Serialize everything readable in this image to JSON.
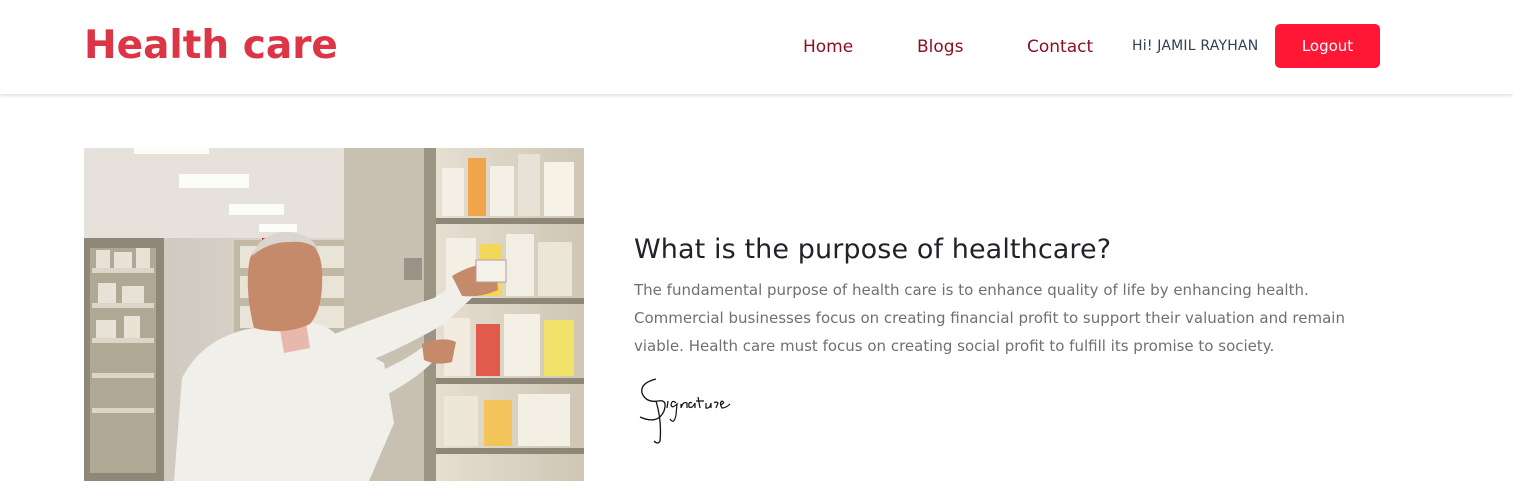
{
  "brand": {
    "name": "Health care",
    "color": "#dc3545"
  },
  "nav": {
    "links": [
      {
        "label": "Home"
      },
      {
        "label": "Blogs"
      },
      {
        "label": "Contact"
      }
    ],
    "greeting": "Hi! JAMIL RAYHAN",
    "logout_label": "Logout",
    "logout_color": "#ff1735"
  },
  "hero": {
    "image_description_icon": "pharmacist-photo",
    "heading": "What is the purpose of healthcare?",
    "paragraph": "The fundamental purpose of health care is to enhance quality of life by enhancing health. Commercial businesses focus on creating financial profit to support their valuation and remain viable. Health care must focus on creating social profit to fulfill its promise to society.",
    "signature": "Signature"
  }
}
